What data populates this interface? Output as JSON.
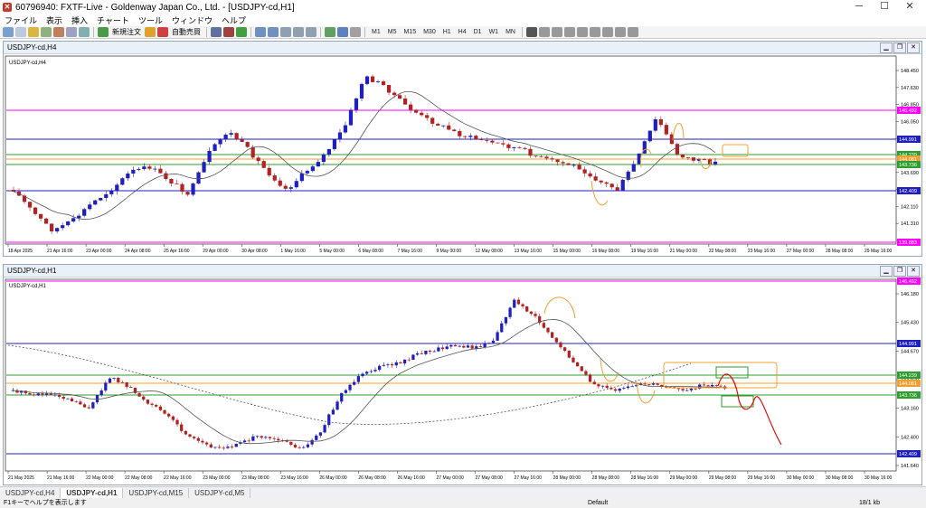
{
  "window": {
    "title": "60796940: FXTF-Live - Goldenway Japan Co., Ltd. - [USDJPY-cd,H1]",
    "icon": "app-logo-icon"
  },
  "menu": [
    "ファイル",
    "表示",
    "挿入",
    "チャート",
    "ツール",
    "ウィンドウ",
    "ヘルプ"
  ],
  "toolbar": {
    "new_order": "新規注文",
    "auto_trade": "自動売買",
    "timeframes": [
      "M1",
      "M5",
      "M15",
      "M30",
      "H1",
      "H4",
      "D1",
      "W1",
      "MN"
    ]
  },
  "chart_h4": {
    "title": "USDJPY-cd,H4",
    "label": "USDJPY-cd,H4",
    "price_ticks": [
      "148.450",
      "147.630",
      "146.850",
      "146.050",
      "145.270",
      "144.470",
      "143.690",
      "142.890",
      "142.110",
      "141.310",
      "140.510"
    ],
    "x_ticks": [
      "18 Apr 2025",
      "21 Apr 16:00",
      "23 Apr 00:00",
      "24 Apr 08:00",
      "25 Apr 16:00",
      "29 Apr 00:00",
      "30 Apr 08:00",
      "1 May 16:00",
      "5 May 00:00",
      "6 May 08:00",
      "7 May 16:00",
      "9 May 00:00",
      "12 May 08:00",
      "13 May 16:00",
      "15 May 00:00",
      "16 May 08:00",
      "19 May 16:00",
      "21 May 00:00",
      "22 May 08:00",
      "23 May 16:00",
      "27 May 00:00",
      "28 May 08:00",
      "29 May 16:00"
    ],
    "level_tags": [
      {
        "text": "146.492",
        "color": "#ff00ff"
      },
      {
        "text": "144.991",
        "color": "#1f1fbf"
      },
      {
        "text": "144.239",
        "color": "#2e9e2e"
      },
      {
        "text": "144.081",
        "color": "#f0a030"
      },
      {
        "text": "143.736",
        "color": "#2e9e2e"
      },
      {
        "text": "142.409",
        "color": "#1f1fbf"
      },
      {
        "text": "139.883",
        "color": "#ff00ff"
      }
    ]
  },
  "chart_h1": {
    "title": "USDJPY-cd,H1",
    "label": "USDJPY-cd,H1",
    "price_ticks": [
      "146.180",
      "145.430",
      "144.670",
      "143.920",
      "143.160",
      "142.400",
      "141.640"
    ],
    "x_ticks": [
      "21 May 2025",
      "21 May 16:00",
      "22 May 00:00",
      "22 May 08:00",
      "22 May 16:00",
      "23 May 00:00",
      "23 May 08:00",
      "23 May 16:00",
      "26 May 00:00",
      "26 May 08:00",
      "26 May 16:00",
      "27 May 00:00",
      "27 May 08:00",
      "27 May 16:00",
      "28 May 00:00",
      "28 May 08:00",
      "28 May 16:00",
      "29 May 00:00",
      "29 May 08:00",
      "29 May 16:00",
      "30 May 00:00",
      "30 May 08:00",
      "30 May 16:00"
    ],
    "level_tags": [
      {
        "text": "146.492",
        "color": "#ff00ff"
      },
      {
        "text": "144.991",
        "color": "#1f1fbf"
      },
      {
        "text": "144.239",
        "color": "#2e9e2e"
      },
      {
        "text": "144.081",
        "color": "#f0a030"
      },
      {
        "text": "143.736",
        "color": "#2e9e2e"
      },
      {
        "text": "142.409",
        "color": "#1f1fbf"
      }
    ]
  },
  "tabs": [
    "USDJPY-cd,H4",
    "USDJPY-cd,H1",
    "USDJPY-cd,M15",
    "USDJPY-cd,M5"
  ],
  "status": {
    "left": "F1キーでヘルプを表示します",
    "middle": "Default",
    "right": "18/1 kb"
  },
  "colors": {
    "bull": "#1f1fbf",
    "bear": "#b22222",
    "ma": "#555555"
  }
}
